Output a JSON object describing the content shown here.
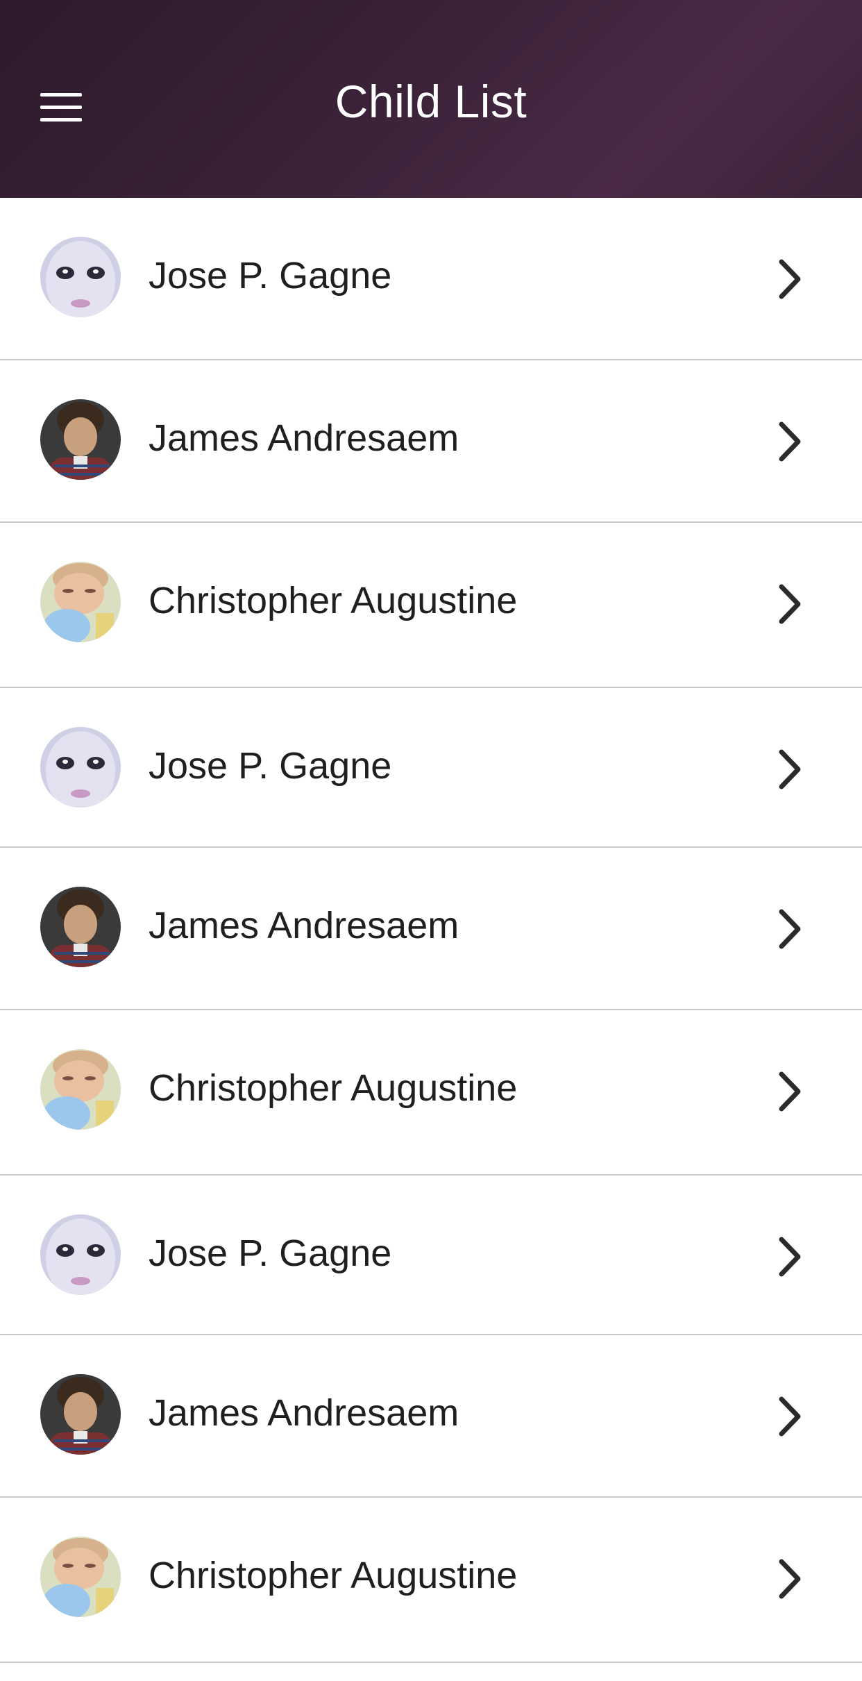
{
  "header": {
    "title": "Child List",
    "menu_icon": "hamburger-menu-icon",
    "background": "#3a2238"
  },
  "children": [
    {
      "name": "Jose P. Gagne",
      "avatar": "avatar-jose"
    },
    {
      "name": "James Andresaem",
      "avatar": "avatar-james"
    },
    {
      "name": "Christopher Augustine",
      "avatar": "avatar-christopher"
    },
    {
      "name": "Jose P. Gagne",
      "avatar": "avatar-jose"
    },
    {
      "name": "James Andresaem",
      "avatar": "avatar-james"
    },
    {
      "name": "Christopher Augustine",
      "avatar": "avatar-christopher"
    },
    {
      "name": "Jose P. Gagne",
      "avatar": "avatar-jose"
    },
    {
      "name": "James Andresaem",
      "avatar": "avatar-james"
    },
    {
      "name": "Christopher Augustine",
      "avatar": "avatar-christopher"
    }
  ],
  "row_icon": "chevron-right-icon"
}
